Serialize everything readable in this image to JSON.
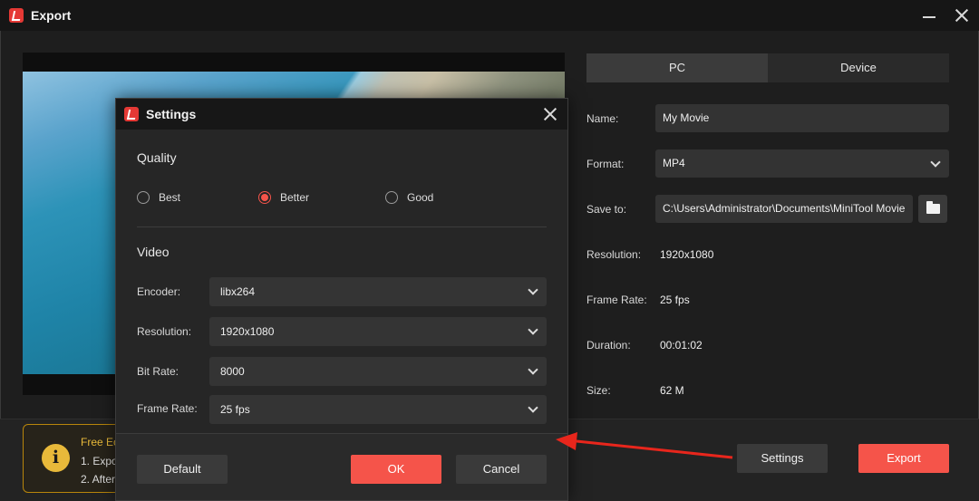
{
  "window": {
    "title": "Export"
  },
  "tabs": [
    {
      "label": "PC",
      "active": true
    },
    {
      "label": "Device",
      "active": false
    }
  ],
  "fields": {
    "name_label": "Name:",
    "name_value": "My Movie",
    "format_label": "Format:",
    "format_value": "MP4",
    "save_label": "Save to:",
    "save_value": "C:\\Users\\Administrator\\Documents\\MiniTool Movie",
    "resolution_label": "Resolution:",
    "resolution_value": "1920x1080",
    "framerate_label": "Frame Rate:",
    "framerate_value": "25 fps",
    "duration_label": "Duration:",
    "duration_value": "00:01:02",
    "size_label": "Size:",
    "size_value": "62 M"
  },
  "notice": {
    "title": "Free Ec",
    "line1": "1. Expo",
    "line2": "2. After"
  },
  "buttons": {
    "settings": "Settings",
    "export": "Export"
  },
  "dialog": {
    "title": "Settings",
    "quality_title": "Quality",
    "quality_options": [
      {
        "label": "Best",
        "checked": false
      },
      {
        "label": "Better",
        "checked": true
      },
      {
        "label": "Good",
        "checked": false
      }
    ],
    "video_title": "Video",
    "rows": [
      {
        "label": "Encoder:",
        "value": "libx264"
      },
      {
        "label": "Resolution:",
        "value": "1920x1080"
      },
      {
        "label": "Bit Rate:",
        "value": "8000"
      },
      {
        "label": "Frame Rate:",
        "value": "25 fps"
      }
    ],
    "default_label": "Default",
    "ok_label": "OK",
    "cancel_label": "Cancel"
  },
  "colors": {
    "accent_red": "#f5544a",
    "notice_yellow": "#e8b93a",
    "arrow_red": "#e8261c"
  }
}
